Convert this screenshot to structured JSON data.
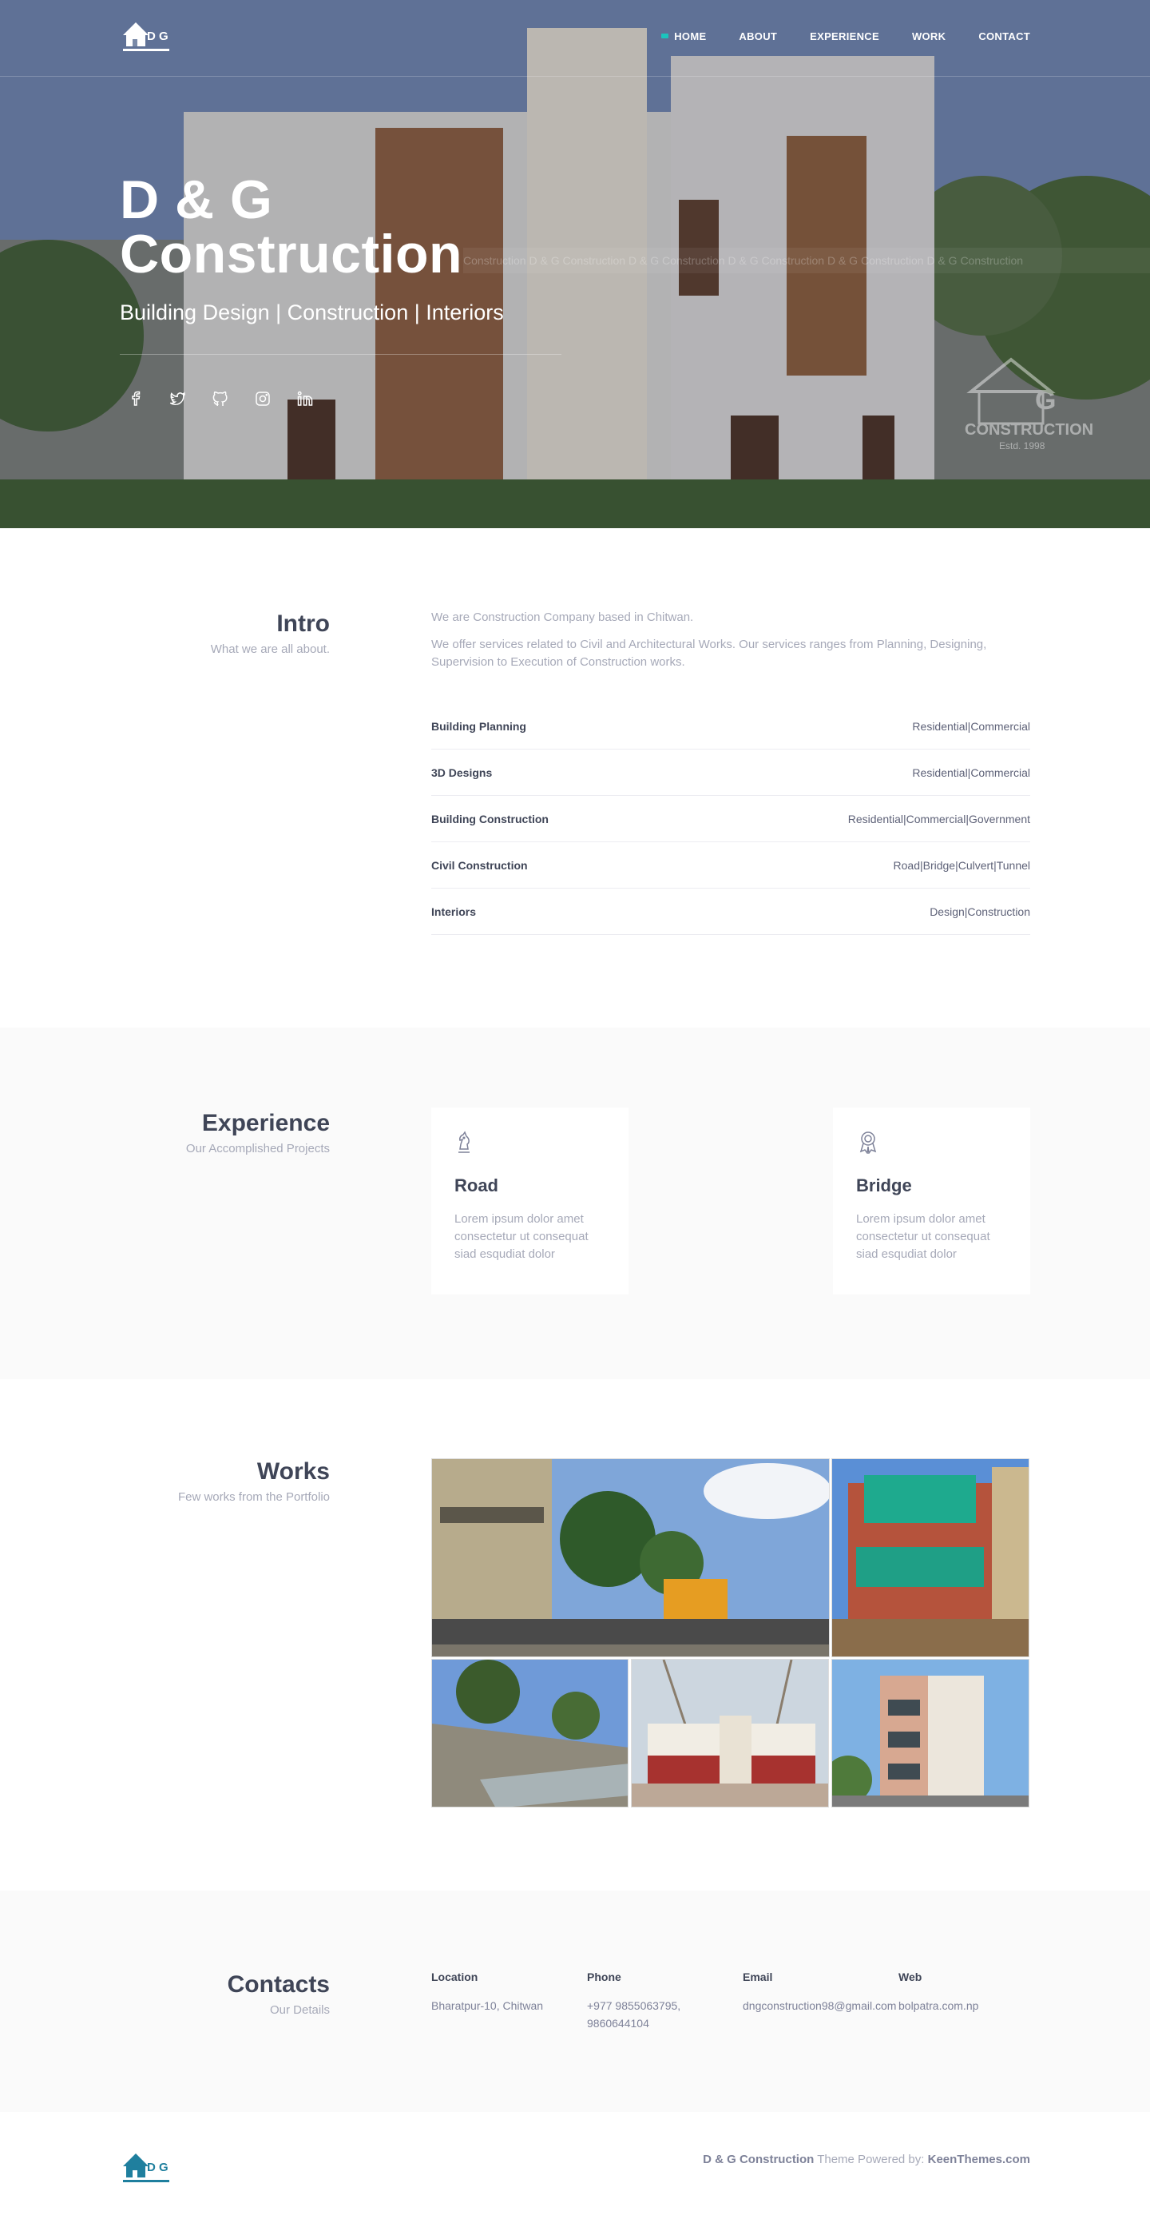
{
  "nav": {
    "logo_text": "D G",
    "links": [
      {
        "label": "HOME"
      },
      {
        "label": "ABOUT"
      },
      {
        "label": "EXPERIENCE"
      },
      {
        "label": "WORK"
      },
      {
        "label": "CONTACT"
      }
    ],
    "active_color": "#1bc5bd"
  },
  "hero": {
    "title_line1": "D & G",
    "title_line2": "Construction",
    "subtitle": "Building Design | Construction | Interiors",
    "socials": [
      "facebook-icon",
      "twitter-icon",
      "github-icon",
      "instagram-icon",
      "linkedin-icon"
    ],
    "ticker_text": "Construction D & G Construction D & G Construction D & G Construction D & G Construction D & G Construction",
    "watermark_name": "CONSTRUCTION",
    "watermark_estd": "Estd. 1998"
  },
  "intro": {
    "title": "Intro",
    "subtitle": "What we are all about.",
    "paragraphs": [
      "We are Construction Company based in Chitwan.",
      "We offer services related to Civil and Architectural Works. Our services ranges from Planning, Designing, Supervision to Execution of Construction works."
    ],
    "services": [
      {
        "name": "Building Planning",
        "value": "Residential|Commercial"
      },
      {
        "name": "3D Designs",
        "value": "Residential|Commercial"
      },
      {
        "name": "Building Construction",
        "value": "Residential|Commercial|Government"
      },
      {
        "name": "Civil Construction",
        "value": "Road|Bridge|Culvert|Tunnel"
      },
      {
        "name": "Interiors",
        "value": "Design|Construction"
      }
    ]
  },
  "experience": {
    "title": "Experience",
    "subtitle": "Our Accomplished Projects",
    "cards": [
      {
        "icon": "chess-knight-icon",
        "title": "Road",
        "text": "Lorem ipsum dolor amet consectetur ut consequat siad esqudiat dolor"
      },
      {
        "icon": "award-ribbon-icon",
        "title": "Bridge",
        "text": "Lorem ipsum dolor amet consectetur ut consequat siad esqudiat dolor"
      }
    ]
  },
  "works": {
    "title": "Works",
    "subtitle": "Few works from the Portfolio"
  },
  "contacts": {
    "title": "Contacts",
    "subtitle": "Our Details",
    "columns": [
      {
        "label": "Location",
        "value": "Bharatpur-10, Chitwan"
      },
      {
        "label": "Phone",
        "value": "+977 9855063795, 9860644104"
      },
      {
        "label": "Email",
        "value": "dngconstruction98@gmail.com"
      },
      {
        "label": "Web",
        "value": "bolpatra.com.np"
      }
    ]
  },
  "footer": {
    "brand": "D & G Construction",
    "powered_text": " Theme Powered by: ",
    "powered_link": "KeenThemes.com",
    "logo_color": "#1f7f9e"
  }
}
